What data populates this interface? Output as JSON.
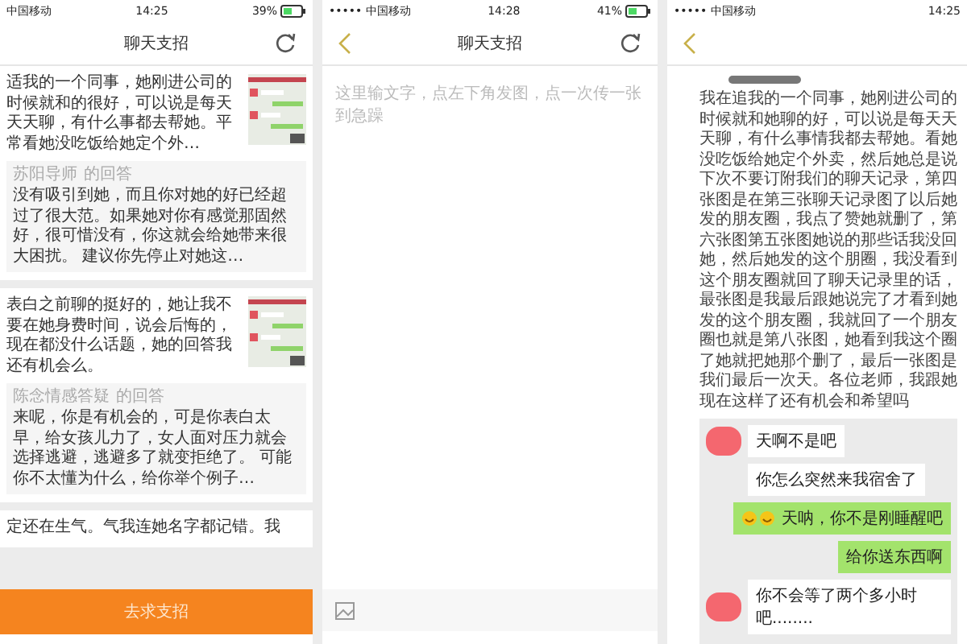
{
  "panels": [
    {
      "kind": "feed",
      "status": {
        "carrier": "中国移动",
        "time": "14:25",
        "battery": "39%"
      },
      "title": "聊天支招",
      "cards": [
        {
          "post": "适我的一个同事，她刚进公司的时候就和的很好，可以说是每天天天聊，有什么事都去帮她。平常看她没吃饭给她定个外…",
          "thumbnail": true,
          "reply": {
            "author": "苏阳导师",
            "suffix": "的回答",
            "text": "没有吸引到她，而且你对她的好已经超过了很大范。如果她对你有感觉那固然好，很可惜没有，你这就会给她带来很大困扰。   建议你先停止对她这…"
          }
        },
        {
          "post": "表白之前聊的挺好的，她让我不要在她身费时间，说会后悔的，现在都没什么话题，她的回答我还有机会么。",
          "thumbnail": true,
          "reply": {
            "author": "陈念情感答疑",
            "suffix": "的回答",
            "text": "来呢，你是有机会的，可是你表白太早，给女孩儿力了，女人面对压力就会选择逃避，逃避多了就变拒绝了。   可能你不太懂为什么，给你举个例子…"
          }
        },
        {
          "post": "定还在生气。气我连她名字都记错。我",
          "thumbnail": false
        }
      ],
      "button": "去求支招"
    },
    {
      "kind": "compose",
      "status": {
        "carrier": "••••• 中国移动",
        "time": "14:28",
        "battery": "41%"
      },
      "title": "聊天支招",
      "placeholder": "这里输文字，点左下角发图，点一次传一张到急躁"
    },
    {
      "kind": "detail",
      "status": {
        "carrier": "••••• 中国移动",
        "time": "14:25"
      },
      "body": "我在追我的一个同事，她刚进公司的时候就和她聊的好，可以说是每天天天聊，有什么事情我都去帮她。看她没吃饭给她定个外卖，然后她总是说下次不要订附我们的聊天记录，第四张图是在第三张聊天记录图了以后她发的朋友圈，我点了赞她就删了，第六张图第五张图她说的那些话我没回她，然后她发的这个朋圈，我没看到这个朋友圈就回了聊天记录里的话，最张图是我最后跟她说完了才看到她发的这个朋友圈，我就回了一个朋友圈也就是第八张图，她看到我这个圈了她就把她那个删了，最后一张图是我们最后一次天。各位老师，我跟她现在这样了还有机会和希望吗",
      "messages": [
        {
          "kind": "incoming",
          "text": "天啊不是吧",
          "avatar": true
        },
        {
          "kind": "incoming",
          "text": "你怎么突然来我宿舍了",
          "avatar": false
        },
        {
          "kind": "outgoing",
          "text": "天呐，你不是刚睡醒吧",
          "emoji": true
        },
        {
          "kind": "outgoing",
          "text": "给你送东西啊",
          "emoji": false
        },
        {
          "kind": "incoming",
          "text": "你不会等了两个多小时吧........",
          "avatar": true
        }
      ]
    }
  ]
}
